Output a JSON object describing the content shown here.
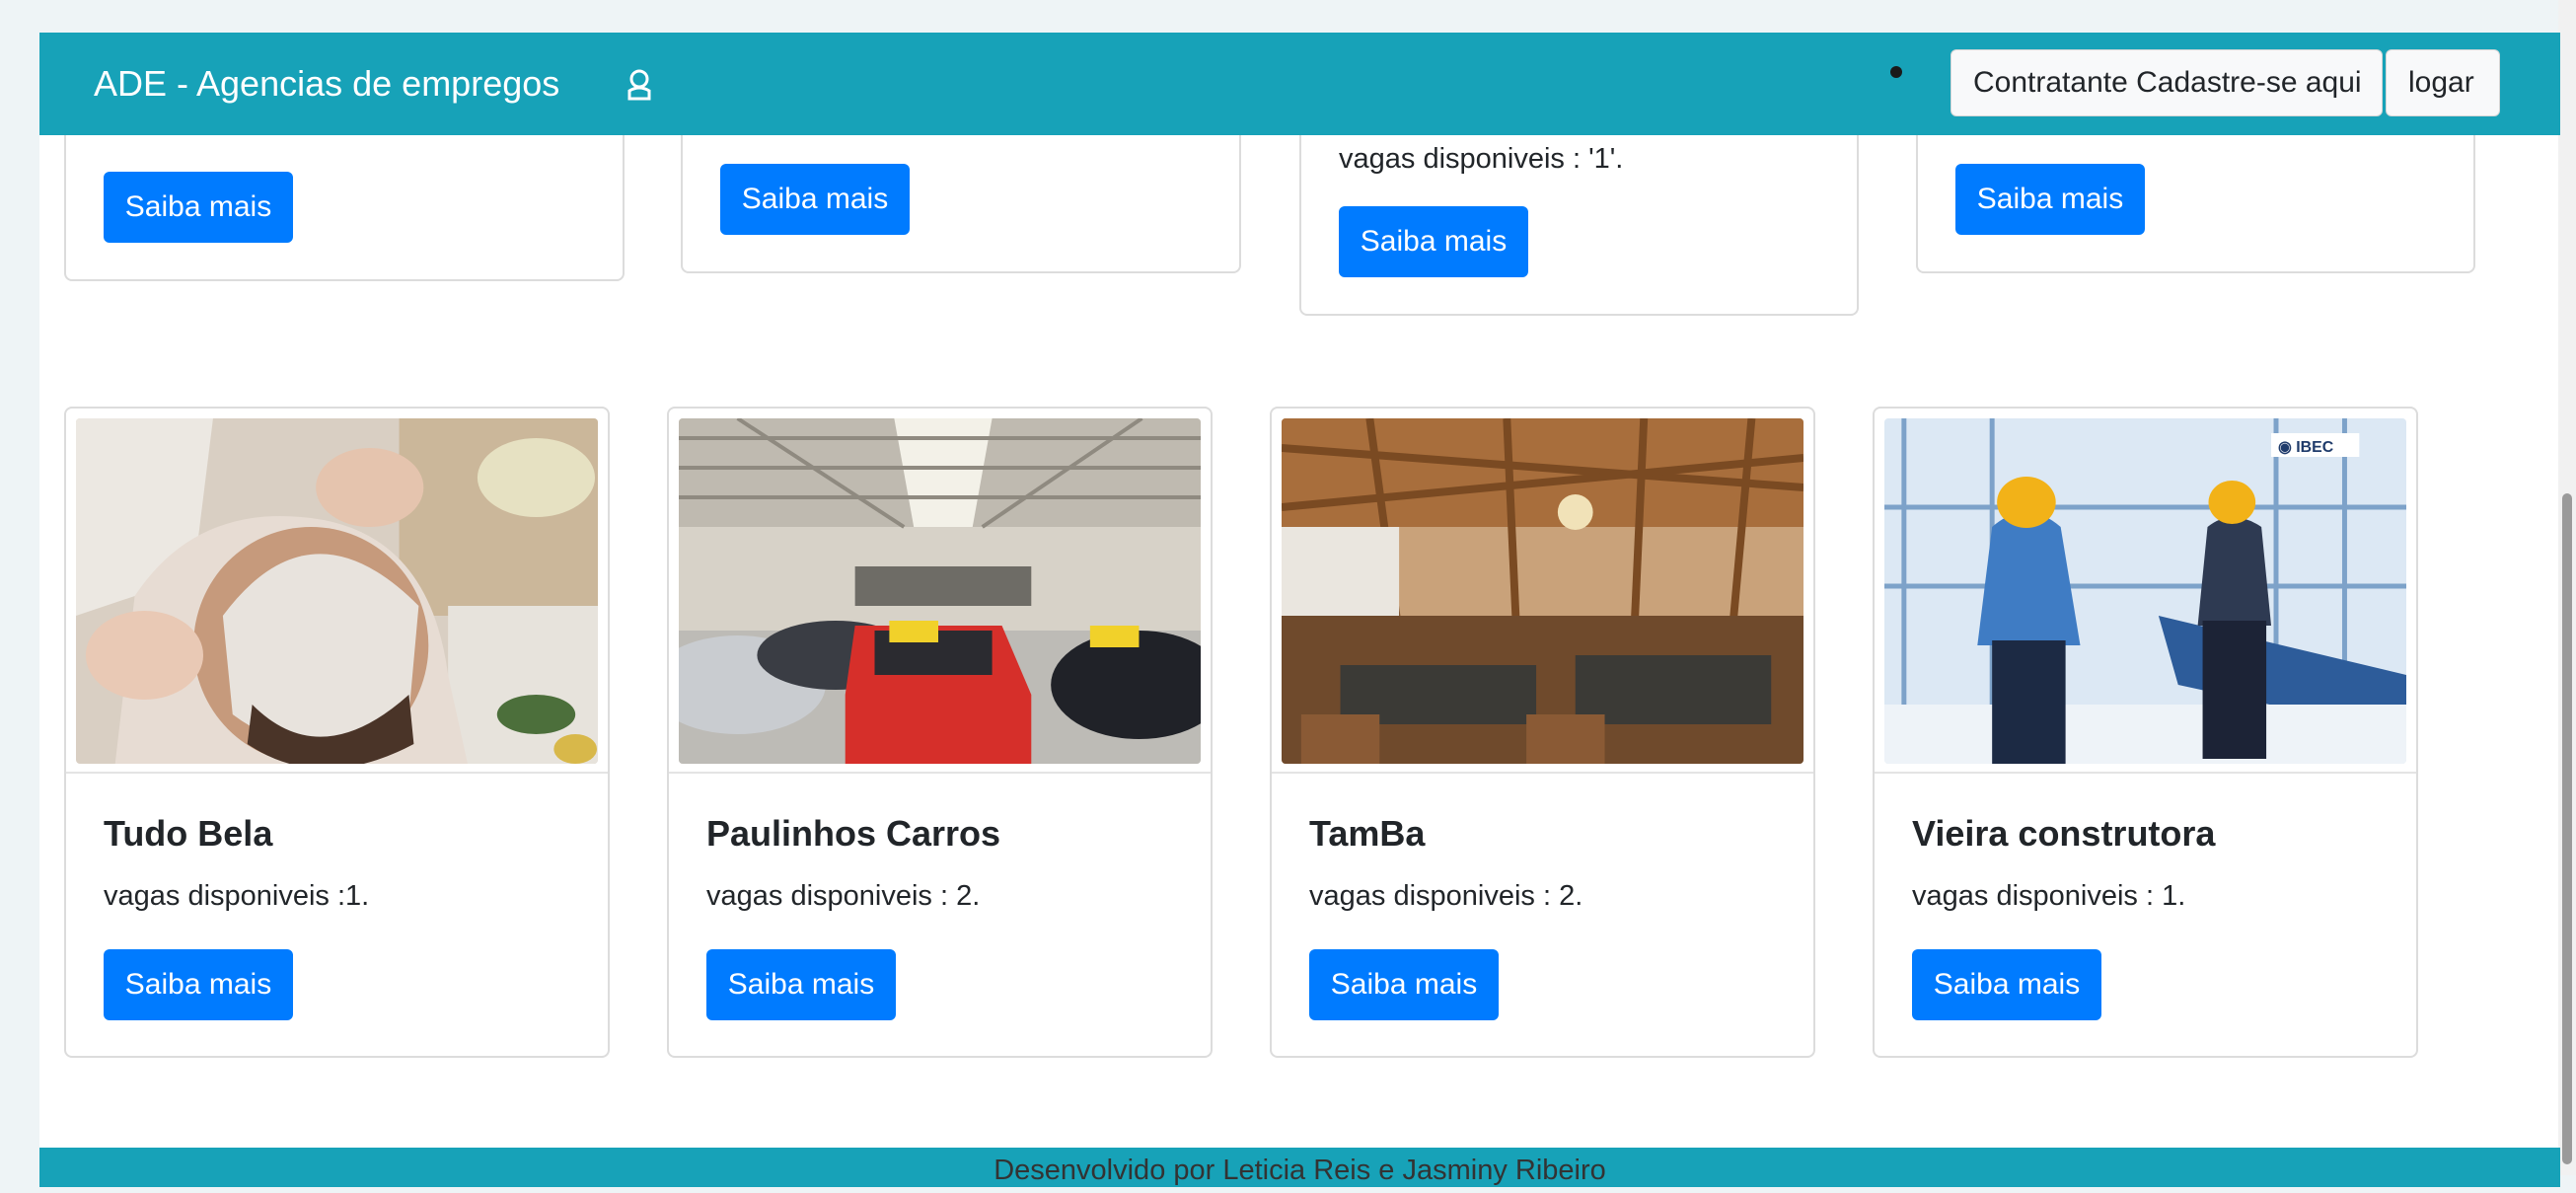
{
  "navbar": {
    "brand": "ADE - Agencias de empregos",
    "brand_icon": "user-badge-icon",
    "signup_label": "Contratante Cadastre-se aqui",
    "login_label": "logar"
  },
  "top_cards": [
    {
      "vagas_text": "",
      "button": "Saiba mais"
    },
    {
      "vagas_text": "",
      "button": "Saiba mais"
    },
    {
      "vagas_text": "vagas disponiveis : '1'.",
      "button": "Saiba mais"
    },
    {
      "vagas_text": "",
      "button": "Saiba mais"
    }
  ],
  "cards": [
    {
      "title": "Tudo Bela",
      "vagas_text": "vagas disponiveis :1.",
      "button": "Saiba mais",
      "image": "spa-facial-photo"
    },
    {
      "title": "Paulinhos Carros",
      "vagas_text": "vagas disponiveis : 2.",
      "button": "Saiba mais",
      "image": "car-showroom-photo"
    },
    {
      "title": "TamBa",
      "vagas_text": "vagas disponiveis : 2.",
      "button": "Saiba mais",
      "image": "restaurant-interior-photo"
    },
    {
      "title": "Vieira construtora",
      "vagas_text": "vagas disponiveis : 1.",
      "button": "Saiba mais",
      "image": "construction-workers-photo",
      "image_logo": "IBEC"
    }
  ],
  "footer": {
    "text": "Desenvolvido por Leticia Reis e Jasminy Ribeiro"
  },
  "colors": {
    "navbar": "#17a2b8",
    "primary_button": "#007bff",
    "page_bg": "#eef4f6"
  }
}
